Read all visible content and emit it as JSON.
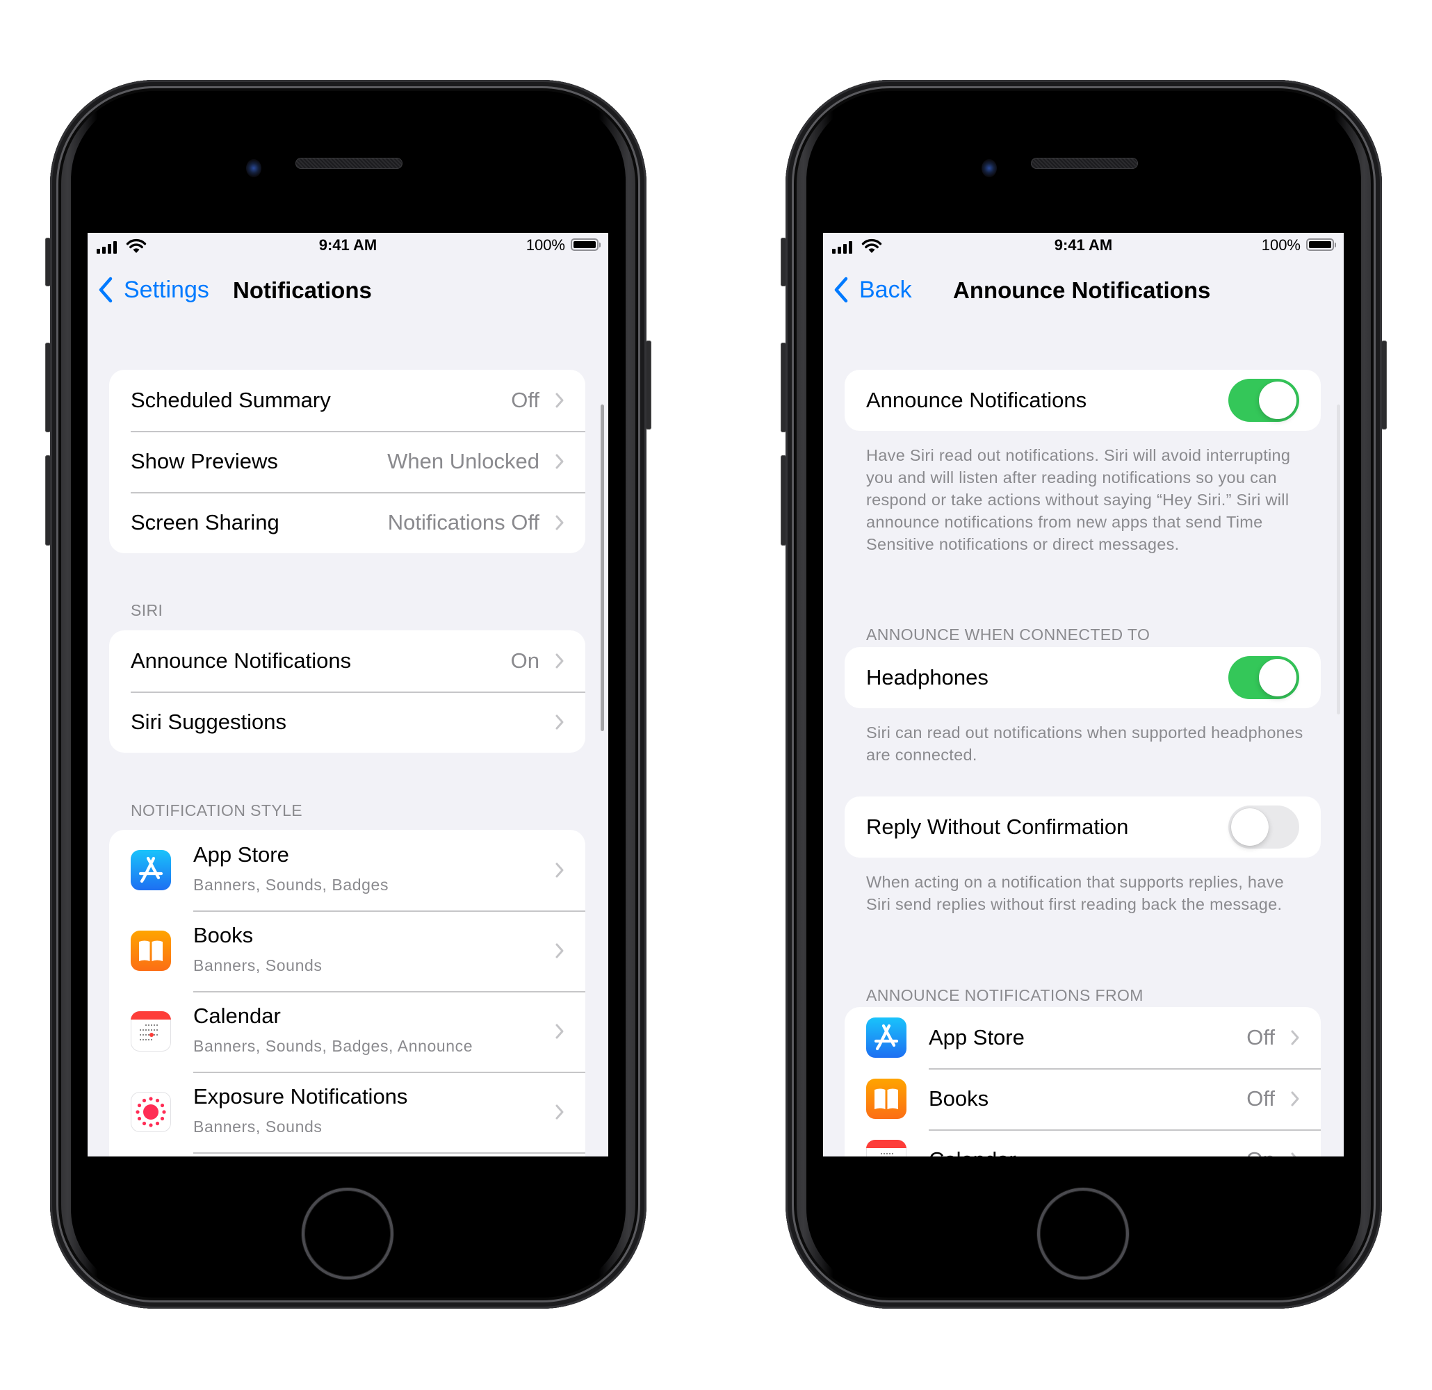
{
  "status_bar": {
    "time": "9:41 AM",
    "battery": "100%"
  },
  "left_screen": {
    "back_label": "Settings",
    "title": "Notifications",
    "group1": [
      {
        "label": "Scheduled Summary",
        "value": "Off"
      },
      {
        "label": "Show Previews",
        "value": "When Unlocked"
      },
      {
        "label": "Screen Sharing",
        "value": "Notifications Off"
      }
    ],
    "siri_header": "SIRI",
    "siri_rows": [
      {
        "label": "Announce Notifications",
        "value": "On"
      },
      {
        "label": "Siri Suggestions",
        "value": ""
      }
    ],
    "style_header": "NOTIFICATION STYLE",
    "apps": [
      {
        "name": "App Store",
        "detail": "Banners, Sounds, Badges",
        "icon": "app-store-icon"
      },
      {
        "name": "Books",
        "detail": "Banners, Sounds",
        "icon": "books-icon"
      },
      {
        "name": "Calendar",
        "detail": "Banners, Sounds, Badges, Announce",
        "icon": "calendar-icon"
      },
      {
        "name": "Exposure Notifications",
        "detail": "Banners, Sounds",
        "icon": "exposure-notifications-icon"
      }
    ]
  },
  "right_screen": {
    "back_label": "Back",
    "title": "Announce Notifications",
    "announce_toggle": {
      "label": "Announce Notifications",
      "on": true
    },
    "announce_footer": "Have Siri read out notifications. Siri will avoid interrupting you and will listen after reading notifications so you can respond or take actions without saying “Hey Siri.” Siri will announce notifications from new apps that send Time Sensitive notifications or direct messages.",
    "connected_header": "ANNOUNCE WHEN CONNECTED TO",
    "headphones_toggle": {
      "label": "Headphones",
      "on": true
    },
    "headphones_footer": "Siri can read out notifications when supported headphones are connected.",
    "reply_toggle": {
      "label": "Reply Without Confirmation",
      "on": false
    },
    "reply_footer": "When acting on a notification that supports replies, have Siri send replies without first reading back the message.",
    "from_header": "ANNOUNCE NOTIFICATIONS FROM",
    "apps": [
      {
        "name": "App Store",
        "value": "Off",
        "icon": "app-store-icon"
      },
      {
        "name": "Books",
        "value": "Off",
        "icon": "books-icon"
      },
      {
        "name": "Calendar",
        "value": "On",
        "icon": "calendar-icon"
      }
    ]
  },
  "colors": {
    "accent": "#007aff",
    "toggle_on": "#34c759",
    "background": "#f2f2f7",
    "secondary_text": "#8a8a8e"
  }
}
